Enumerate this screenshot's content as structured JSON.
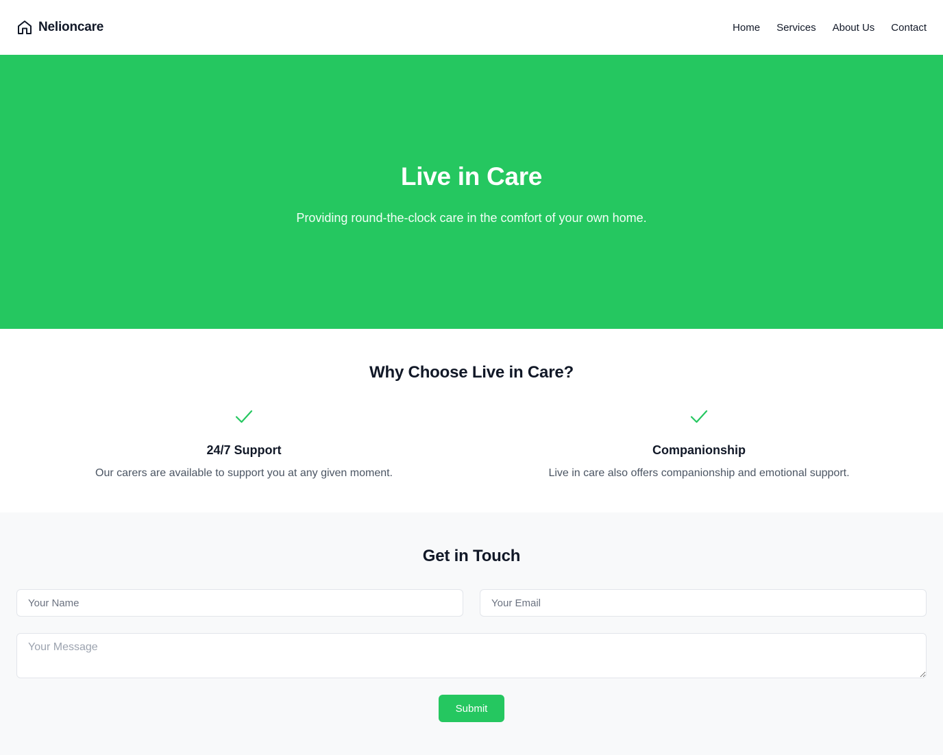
{
  "header": {
    "brand_icon": "home-icon",
    "brand_name": "Nelioncare",
    "nav": [
      {
        "label": "Home"
      },
      {
        "label": "Services"
      },
      {
        "label": "About Us"
      },
      {
        "label": "Contact"
      }
    ]
  },
  "hero": {
    "title": "Live in Care",
    "subtitle": "Providing round-the-clock care in the comfort of your own home.",
    "background_color": "#25c760"
  },
  "features": {
    "title": "Why Choose Live in Care?",
    "items": [
      {
        "icon": "check-icon",
        "title": "24/7 Support",
        "text": "Our carers are available to support you at any given moment."
      },
      {
        "icon": "check-icon",
        "title": "Companionship",
        "text": "Live in care also offers companionship and emotional support."
      }
    ]
  },
  "contact": {
    "title": "Get in Touch",
    "name_placeholder": "Your Name",
    "email_placeholder": "Your Email",
    "message_placeholder": "Your Message",
    "submit_label": "Submit"
  },
  "colors": {
    "accent": "#25c760",
    "muted_text": "#4b5563",
    "section_bg": "#f8f9fa"
  }
}
